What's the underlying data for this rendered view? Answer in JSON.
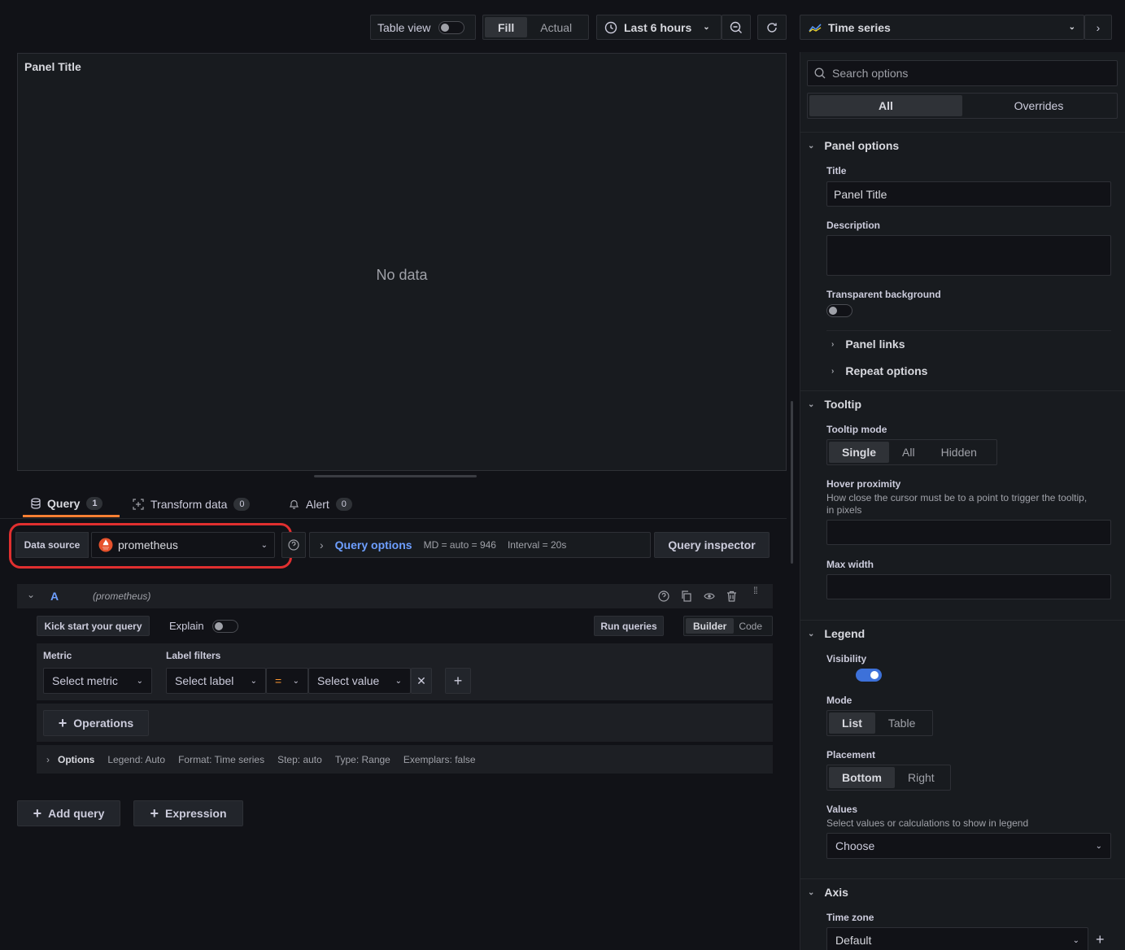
{
  "toolbar": {
    "table_view": "Table view",
    "fill": "Fill",
    "actual": "Actual",
    "time_range": "Last 6 hours",
    "viz_type": "Time series"
  },
  "panel": {
    "title": "Panel Title",
    "no_data": "No data"
  },
  "tabs": [
    {
      "label": "Query",
      "count": "1"
    },
    {
      "label": "Transform data",
      "count": "0"
    },
    {
      "label": "Alert",
      "count": "0"
    }
  ],
  "datasource": {
    "label": "Data source",
    "value": "prometheus",
    "query_options": "Query options",
    "md": "MD = auto = 946",
    "interval": "Interval = 20s",
    "inspector": "Query inspector"
  },
  "query": {
    "ref": "A",
    "ds": "(prometheus)",
    "kick_start": "Kick start your query",
    "explain": "Explain",
    "run": "Run queries",
    "builder": "Builder",
    "code": "Code",
    "metric_label": "Metric",
    "metric_placeholder": "Select metric",
    "label_filters": "Label filters",
    "select_label": "Select label",
    "op": "=",
    "select_value": "Select value",
    "operations": "Operations",
    "options_label": "Options",
    "legend": "Legend: Auto",
    "format": "Format: Time series",
    "step": "Step: auto",
    "type": "Type: Range",
    "exemplars": "Exemplars: false"
  },
  "bottom": {
    "add_query": "Add query",
    "expression": "Expression"
  },
  "options": {
    "search_placeholder": "Search options",
    "tab_all": "All",
    "tab_overrides": "Overrides",
    "panel_options": "Panel options",
    "title_label": "Title",
    "title_value": "Panel Title",
    "description_label": "Description",
    "transparent_label": "Transparent background",
    "panel_links": "Panel links",
    "repeat_options": "Repeat options",
    "tooltip": "Tooltip",
    "tooltip_mode": "Tooltip mode",
    "tooltip_single": "Single",
    "tooltip_all": "All",
    "tooltip_hidden": "Hidden",
    "hover_proximity": "Hover proximity",
    "hover_desc": "How close the cursor must be to a point to trigger the tooltip, in pixels",
    "max_width": "Max width",
    "legend": "Legend",
    "visibility": "Visibility",
    "mode": "Mode",
    "mode_list": "List",
    "mode_table": "Table",
    "placement": "Placement",
    "placement_bottom": "Bottom",
    "placement_right": "Right",
    "values": "Values",
    "values_desc": "Select values or calculations to show in legend",
    "values_choose": "Choose",
    "axis": "Axis",
    "time_zone": "Time zone",
    "time_zone_value": "Default"
  },
  "colors": {
    "accent": "#3d71d9",
    "highlight": "#e02f2f",
    "tab_underline": "#ff7f33",
    "prometheus": "#e6522c"
  }
}
